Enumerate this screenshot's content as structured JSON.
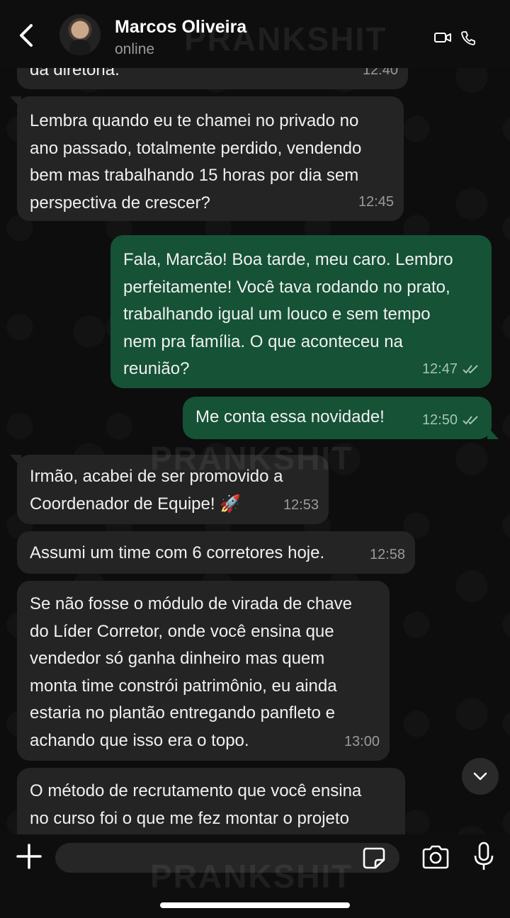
{
  "header": {
    "contact_name": "Marcos Oliveira",
    "status": "online"
  },
  "watermark": "PRANKSHIT",
  "messages": [
    {
      "direction": "in",
      "lines": [
        "da diretoria."
      ],
      "time": "12:40"
    },
    {
      "direction": "in",
      "lines": [
        "Lembra quando eu te chamei no privado no",
        "ano passado, totalmente perdido, vendendo",
        "bem mas trabalhando 15 horas por dia sem",
        "perspectiva de crescer?"
      ],
      "time": "12:45"
    },
    {
      "direction": "out",
      "lines": [
        "Fala, Marcão! Boa tarde, meu caro. Lembro",
        "perfeitamente! Você tava rodando no prato,",
        "trabalhando igual um louco e sem tempo",
        "nem pra família. O que aconteceu na",
        "reunião?"
      ],
      "time": "12:47",
      "read": true
    },
    {
      "direction": "out",
      "lines": [
        "Me conta essa novidade!"
      ],
      "time": "12:50",
      "read": true
    },
    {
      "direction": "in",
      "lines": [
        "Irmão, acabei de ser promovido a",
        "Coordenador de Equipe! 🚀"
      ],
      "time": "12:53"
    },
    {
      "direction": "in",
      "lines": [
        "Assumi um time com 6 corretores hoje."
      ],
      "time": "12:58"
    },
    {
      "direction": "in",
      "lines": [
        "Se não fosse o módulo de virada de chave",
        "do Líder Corretor, onde você ensina que",
        "vendedor só ganha dinheiro mas quem",
        "monta time constrói patrimônio, eu ainda",
        "estaria no plantão entregando panfleto e",
        "achando que isso era o topo."
      ],
      "time": "13:00"
    },
    {
      "direction": "in",
      "lines": [
        "O método de recrutamento que você ensina",
        "no curso foi o que me fez montar o projeto"
      ],
      "time": ""
    }
  ],
  "composer": {
    "placeholder": "",
    "value": ""
  },
  "colors": {
    "incoming_bubble": "#242424",
    "outgoing_bubble": "#155236",
    "background": "#0d0d0d"
  },
  "icons": [
    "back-arrow-icon",
    "video-call-icon",
    "phone-icon",
    "plus-icon",
    "sticker-icon",
    "camera-icon",
    "microphone-icon",
    "chevron-down-icon",
    "double-check-icon"
  ]
}
